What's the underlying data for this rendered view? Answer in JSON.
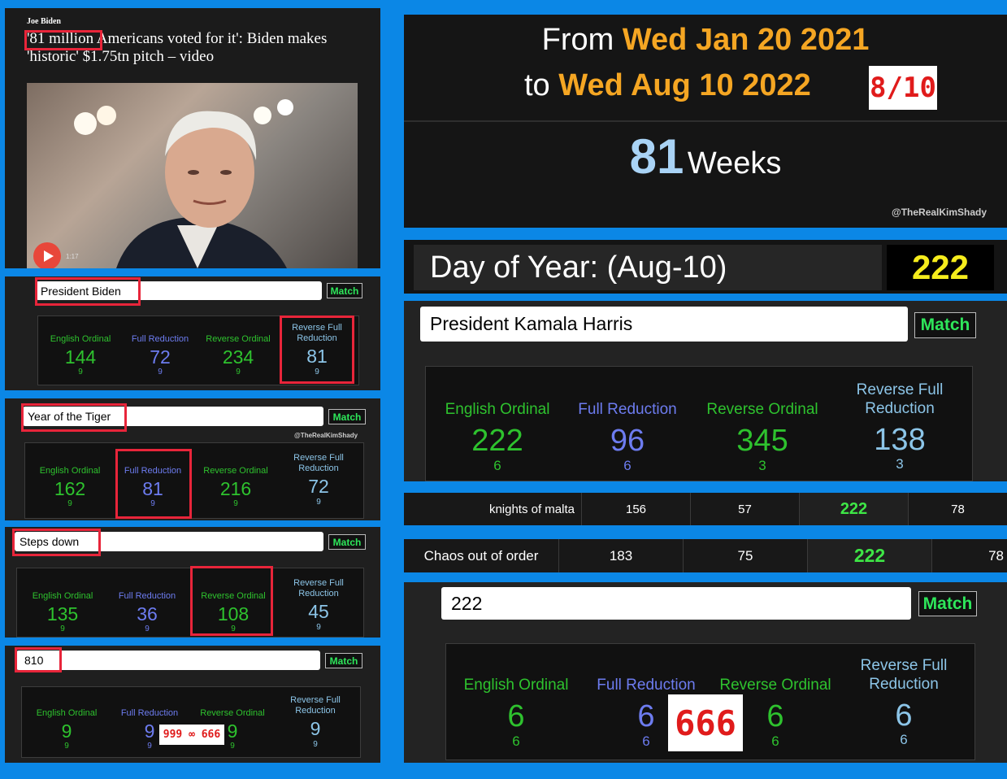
{
  "article": {
    "kicker": "Joe Biden",
    "headline_highlight": "'81 million",
    "headline_rest": " Americans voted for it': Biden makes 'historic' $1.75tn pitch – video",
    "video_time": "1:17"
  },
  "calculators": [
    {
      "phrase": "President Biden",
      "match_label": "Match",
      "columns": [
        {
          "label": "English Ordinal",
          "value": "144",
          "reduced": "9"
        },
        {
          "label": "Full Reduction",
          "value": "72",
          "reduced": "9"
        },
        {
          "label": "Reverse Ordinal",
          "value": "234",
          "reduced": "9"
        },
        {
          "label": "Reverse Full Reduction",
          "value": "81",
          "reduced": "9"
        }
      ]
    },
    {
      "phrase": "Year of the Tiger",
      "match_label": "Match",
      "watermark": "@TheRealKimShady",
      "columns": [
        {
          "label": "English Ordinal",
          "value": "162",
          "reduced": "9"
        },
        {
          "label": "Full Reduction",
          "value": "81",
          "reduced": "9"
        },
        {
          "label": "Reverse Ordinal",
          "value": "216",
          "reduced": "9"
        },
        {
          "label": "Reverse Full Reduction",
          "value": "72",
          "reduced": "9"
        }
      ]
    },
    {
      "phrase": "Steps down",
      "match_label": "Match",
      "columns": [
        {
          "label": "English Ordinal",
          "value": "135",
          "reduced": "9"
        },
        {
          "label": "Full Reduction",
          "value": "36",
          "reduced": "9"
        },
        {
          "label": "Reverse Ordinal",
          "value": "108",
          "reduced": "9"
        },
        {
          "label": "Reverse Full Reduction",
          "value": "45",
          "reduced": "9"
        }
      ]
    },
    {
      "phrase": "810",
      "match_label": "Match",
      "note": "999 ∞ 666",
      "columns": [
        {
          "label": "English Ordinal",
          "value": "9",
          "reduced": "9"
        },
        {
          "label": "Full Reduction",
          "value": "9",
          "reduced": "9"
        },
        {
          "label": "Reverse Ordinal",
          "value": "9",
          "reduced": "9"
        },
        {
          "label": "Reverse Full Reduction",
          "value": "9",
          "reduced": "9"
        }
      ]
    }
  ],
  "date_calc": {
    "from_label": "From",
    "from_date": "Wed Jan 20 2021",
    "to_label": "to",
    "to_date": "Wed Aug 10 2022",
    "to_badge": "8/10",
    "weeks_value": "81",
    "weeks_label": "Weeks",
    "watermark": "@TheRealKimShady"
  },
  "day_of_year": {
    "label": "Day of Year: (Aug-10)",
    "value": "222"
  },
  "right_calcs": [
    {
      "phrase": "President Kamala Harris",
      "match_label": "Match",
      "columns": [
        {
          "label": "English Ordinal",
          "value": "222",
          "reduced": "6"
        },
        {
          "label": "Full Reduction",
          "value": "96",
          "reduced": "6"
        },
        {
          "label": "Reverse Ordinal",
          "value": "345",
          "reduced": "3"
        },
        {
          "label": "Reverse Full Reduction",
          "value": "138",
          "reduced": "3"
        }
      ]
    },
    {
      "phrase": "222",
      "match_label": "Match",
      "note": "666",
      "columns": [
        {
          "label": "English Ordinal",
          "value": "6",
          "reduced": "6"
        },
        {
          "label": "Full Reduction",
          "value": "6",
          "reduced": "6"
        },
        {
          "label": "Reverse Ordinal",
          "value": "6",
          "reduced": "6"
        },
        {
          "label": "Reverse Full Reduction",
          "value": "6",
          "reduced": "6"
        }
      ]
    }
  ],
  "table_rows": [
    {
      "phrase": "knights of malta",
      "values": [
        "156",
        "57",
        "222",
        "78"
      ]
    },
    {
      "phrase": "Chaos out of order",
      "values": [
        "183",
        "75",
        "222",
        "78"
      ]
    }
  ]
}
